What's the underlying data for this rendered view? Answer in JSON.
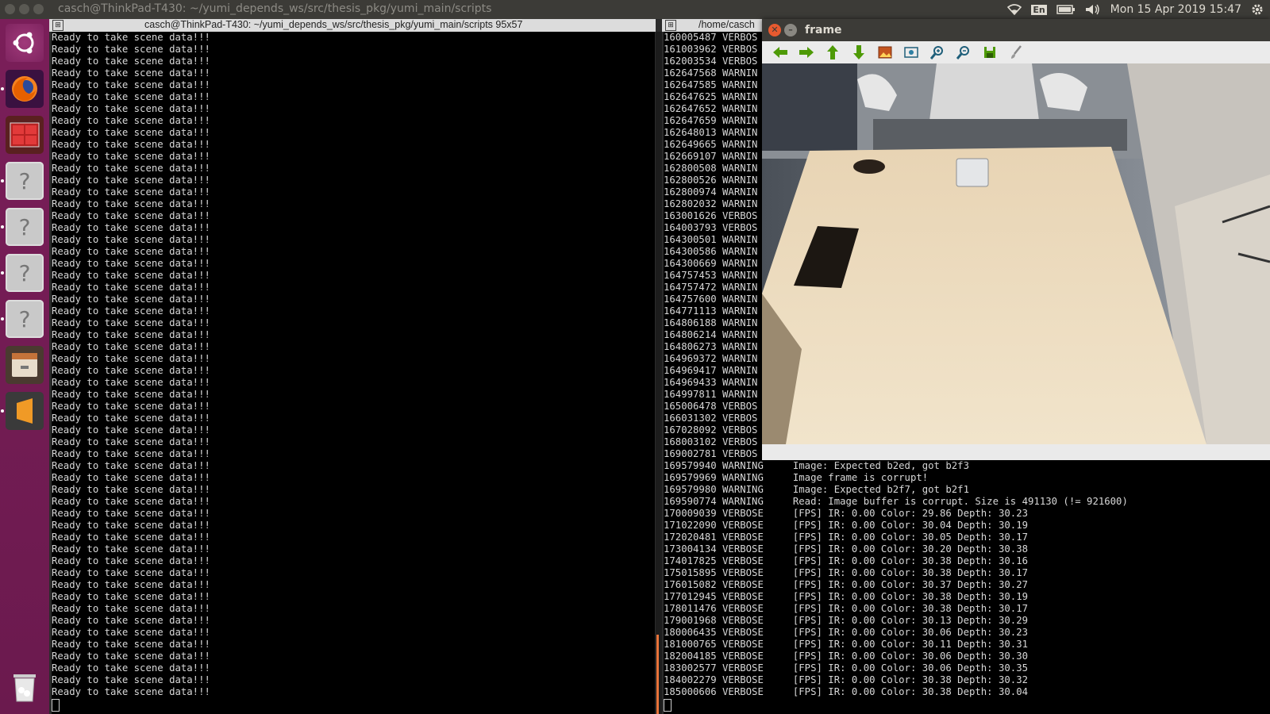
{
  "topbar": {
    "window_title": "casch@ThinkPad-T430: ~/yumi_depends_ws/src/thesis_pkg/yumi_main/scripts",
    "lang": "En",
    "clock": "Mon 15 Apr 2019 15:47"
  },
  "left_terminal": {
    "title": "casch@ThinkPad-T430: ~/yumi_depends_ws/src/thesis_pkg/yumi_main/scripts 95x57",
    "line_text": "Ready to take scene data!!!"
  },
  "right_terminal": {
    "title": "/home/casch",
    "top_lines": [
      "160005487 VERBOS",
      "161003962 VERBOS",
      "162003534 VERBOS",
      "162647568 WARNIN",
      "162647585 WARNIN",
      "162647625 WARNIN",
      "162647652 WARNIN",
      "162647659 WARNIN",
      "162648013 WARNIN",
      "162649665 WARNIN",
      "162669107 WARNIN",
      "162800508 WARNIN",
      "162800526 WARNIN",
      "162800974 WARNIN",
      "162802032 WARNIN",
      "163001626 VERBOS",
      "164003793 VERBOS",
      "164300501 WARNIN",
      "164300586 WARNIN",
      "164300669 WARNIN",
      "164757453 WARNIN",
      "164757472 WARNIN",
      "164757600 WARNIN",
      "164771113 WARNIN",
      "164806188 WARNIN",
      "164806214 WARNIN",
      "164806273 WARNIN",
      "164969372 WARNIN",
      "164969417 WARNIN",
      "164969433 WARNIN",
      "164997811 WARNIN",
      "165006478 VERBOS",
      "166031302 VERBOS",
      "167028092 VERBOS",
      "168003102 VERBOS",
      "169002781 VERBOS"
    ],
    "bottom_lines": [
      "169579940 WARNING     Image: Expected b2ed, got b2f3",
      "169579969 WARNING     Image frame is corrupt!",
      "169579980 WARNING     Image: Expected b2f7, got b2f1",
      "169590774 WARNING     Read: Image buffer is corrupt. Size is 491130 (!= 921600)",
      "170009039 VERBOSE     [FPS] IR: 0.00 Color: 29.86 Depth: 30.23",
      "171022090 VERBOSE     [FPS] IR: 0.00 Color: 30.04 Depth: 30.19",
      "172020481 VERBOSE     [FPS] IR: 0.00 Color: 30.05 Depth: 30.17",
      "173004134 VERBOSE     [FPS] IR: 0.00 Color: 30.20 Depth: 30.38",
      "174017825 VERBOSE     [FPS] IR: 0.00 Color: 30.38 Depth: 30.16",
      "175015895 VERBOSE     [FPS] IR: 0.00 Color: 30.38 Depth: 30.17",
      "176015082 VERBOSE     [FPS] IR: 0.00 Color: 30.37 Depth: 30.27",
      "177012945 VERBOSE     [FPS] IR: 0.00 Color: 30.38 Depth: 30.19",
      "178011476 VERBOSE     [FPS] IR: 0.00 Color: 30.38 Depth: 30.17",
      "179001968 VERBOSE     [FPS] IR: 0.00 Color: 30.13 Depth: 30.29",
      "180006435 VERBOSE     [FPS] IR: 0.00 Color: 30.06 Depth: 30.23",
      "181000765 VERBOSE     [FPS] IR: 0.00 Color: 30.11 Depth: 30.31",
      "182004185 VERBOSE     [FPS] IR: 0.00 Color: 30.06 Depth: 30.30",
      "183002577 VERBOSE     [FPS] IR: 0.00 Color: 30.06 Depth: 30.35",
      "184002279 VERBOSE     [FPS] IR: 0.00 Color: 30.38 Depth: 30.32",
      "185000606 VERBOSE     [FPS] IR: 0.00 Color: 30.38 Depth: 30.04"
    ]
  },
  "frame_window": {
    "title": "frame",
    "toolbar": [
      "arrow-left-icon",
      "arrow-right-icon",
      "arrow-up-icon",
      "arrow-down-icon",
      "image-icon",
      "fit-icon",
      "zoom-in-icon",
      "zoom-out-icon",
      "save-icon",
      "brush-icon"
    ]
  },
  "launcher": {
    "items": [
      "ubuntu-dash-icon",
      "firefox-icon",
      "workspaces-icon",
      "unknown-app-icon",
      "unknown-app-icon",
      "unknown-app-icon",
      "unknown-app-icon",
      "file-manager-icon",
      "sublime-text-icon",
      "trash-icon"
    ]
  },
  "colors": {
    "launcher": "#7a1e59",
    "panel": "#3c3b37",
    "terminal_bg": "#000000",
    "accent": "#e85a2f"
  }
}
